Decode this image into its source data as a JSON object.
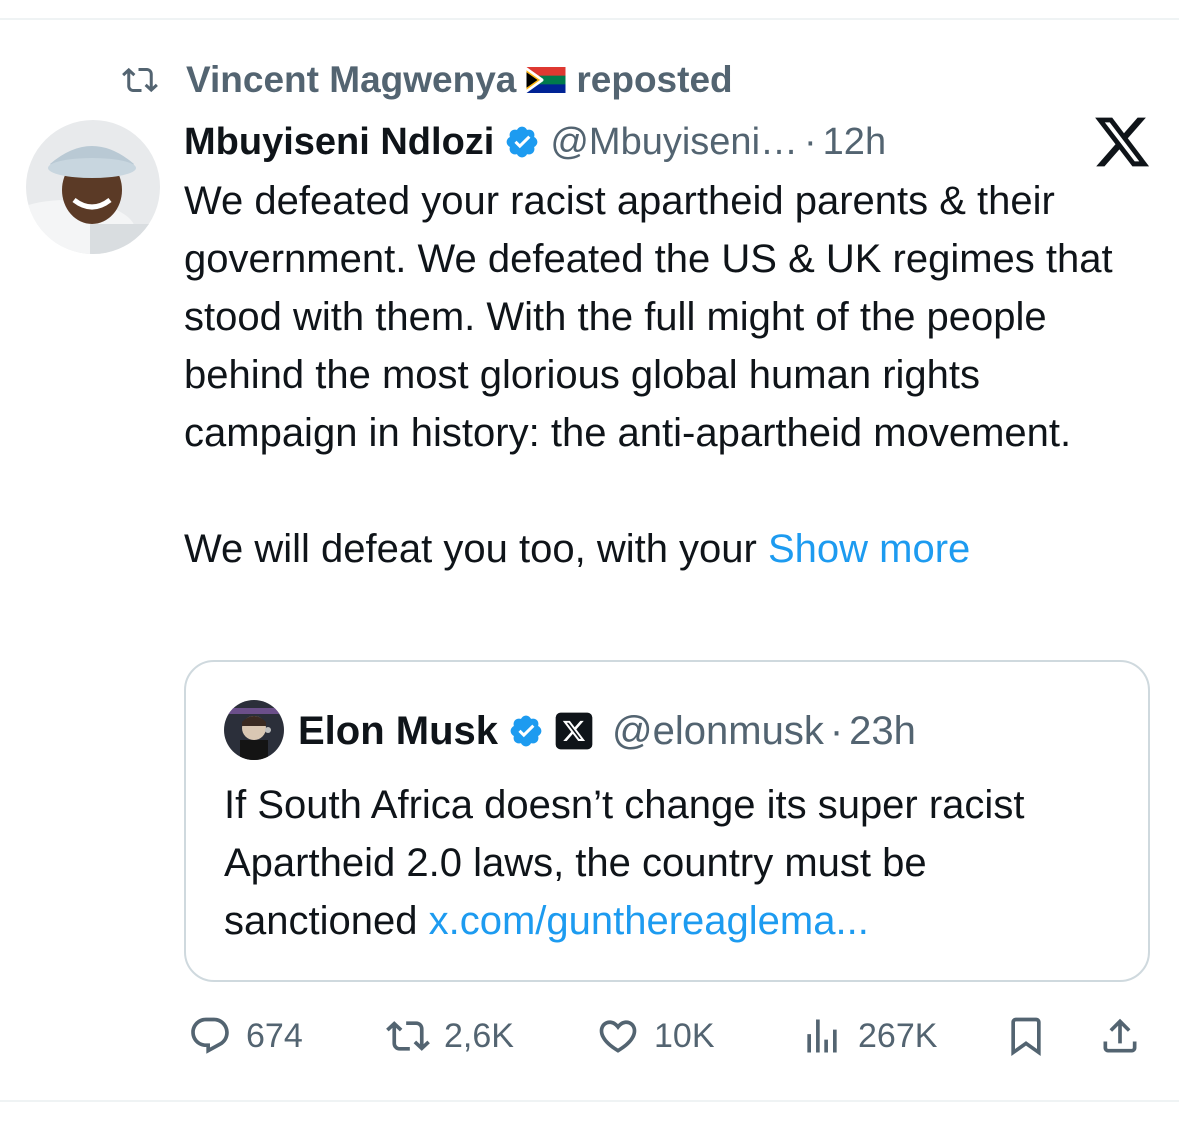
{
  "repost": {
    "user": "Vincent Magwenya",
    "suffix": "reposted"
  },
  "post": {
    "author_name": "Mbuyiseni Ndlozi",
    "handle": "@Mbuyiseni…",
    "separator": "·",
    "time": "12h",
    "text": "We defeated your racist apartheid parents & their government. We defeated the US & UK regimes that stood with them. With the full might of the people behind the most glorious global human rights campaign in history: the anti-apartheid movement.\n\nWe will defeat you too, with your ",
    "show_more": "Show more"
  },
  "quote": {
    "author_name": "Elon Musk",
    "handle": "@elonmusk",
    "separator": "·",
    "time": "23h",
    "text": "If South Africa doesn’t change its super racist Apartheid 2.0 laws, the country must be sanctioned ",
    "link": "x.com/gunthereaglema..."
  },
  "actions": {
    "replies": "674",
    "reposts": "2,6K",
    "likes": "10K",
    "views": "267K"
  },
  "icons": {
    "repost": "repost-icon",
    "flag": "south-africa-flag-icon",
    "verified": "verified-badge-icon",
    "x_logo": "x-logo-icon",
    "reply": "reply-icon",
    "like": "heart-icon",
    "views": "views-icon",
    "bookmark": "bookmark-icon",
    "share": "share-icon"
  },
  "colors": {
    "accent": "#1d9bf0",
    "muted": "#536471",
    "text": "#0f1419",
    "border": "#cfd9de"
  }
}
